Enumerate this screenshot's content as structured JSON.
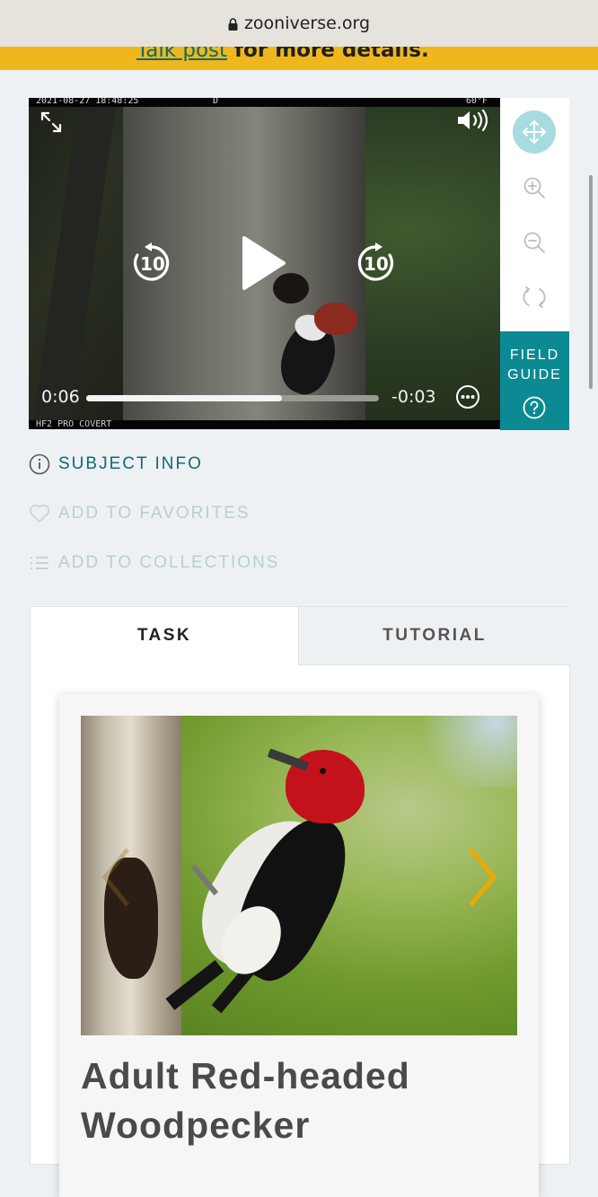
{
  "browser": {
    "domain": "zooniverse.org"
  },
  "banner": {
    "link_text": "Talk post",
    "rest_text": " for more details."
  },
  "viewer": {
    "timestamp": "2021-08-27 18:48:25",
    "flag": "D",
    "temperature": "60°F",
    "camera_model": "HF2 PRO COVERT",
    "current_time": "0:06",
    "remaining_time": "-0:03",
    "progress": 0.67,
    "rewind_seconds": "10",
    "forward_seconds": "10"
  },
  "toolbar": {
    "tools": [
      {
        "name": "move-tool",
        "icon": "move-icon",
        "active": true
      },
      {
        "name": "zoom-in-tool",
        "icon": "zoom-in-icon",
        "active": false
      },
      {
        "name": "zoom-out-tool",
        "icon": "zoom-out-icon",
        "active": false
      },
      {
        "name": "reset-tool",
        "icon": "rotate-icon",
        "active": false
      }
    ],
    "field_guide_line1": "FIELD",
    "field_guide_line2": "GUIDE",
    "field_guide_icon": "help-icon"
  },
  "meta": {
    "subject_info": "SUBJECT INFO",
    "add_favorites": "ADD TO FAVORITES",
    "add_collections": "ADD TO COLLECTIONS"
  },
  "tabs": {
    "task": "TASK",
    "tutorial": "TUTORIAL"
  },
  "card": {
    "title_line1": "Adult Red-headed",
    "title_line2": "Woodpecker",
    "prev_icon": "chevron-left-icon",
    "next_icon": "chevron-right-icon"
  },
  "colors": {
    "accent_teal": "#0c8a93",
    "banner_yellow": "#f0b71c",
    "active_tool": "#a8dbe0",
    "carousel_arrow": "#f0a800"
  }
}
